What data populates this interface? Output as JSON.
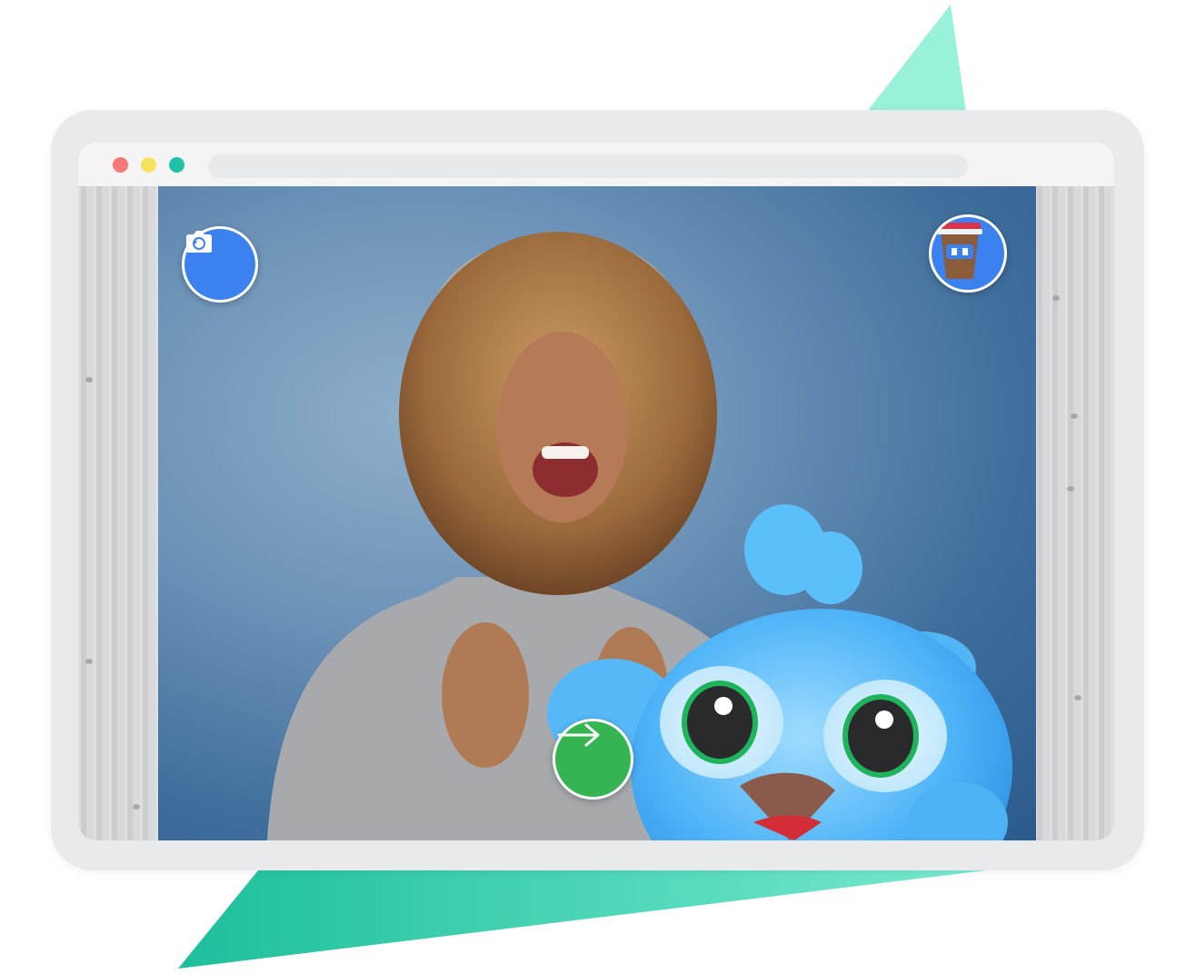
{
  "colors": {
    "accent_triangle_top": "#99f1da",
    "accent_triangle_bottom": "#2cc9a6",
    "device_frame": "#e9eaeb",
    "dot_red": "#f47a7a",
    "dot_yellow": "#f5e35f",
    "dot_green": "#1fc2a5",
    "camera_button": "#3b82f0",
    "avatar_button": "#3b82f0",
    "next_button": "#34b551"
  },
  "browser": {
    "window_controls": [
      "close-dot",
      "minimize-dot",
      "maximize-dot"
    ],
    "url_value": ""
  },
  "photo_booth": {
    "camera_button_icon": "camera-flip-icon",
    "avatar_icon": "coffee-cup-icon",
    "next_button_icon": "arrow-right-icon",
    "character_icon": "blue-bird-mascot"
  }
}
